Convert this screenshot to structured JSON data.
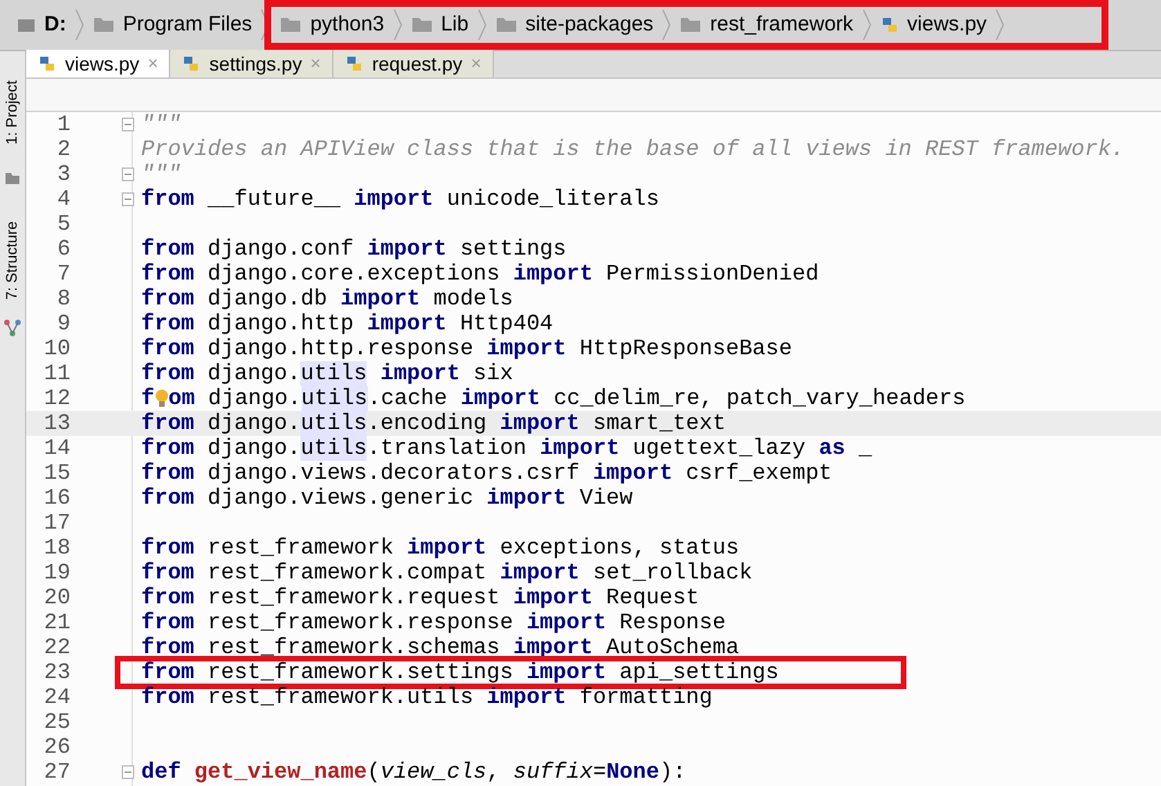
{
  "breadcrumbs": [
    {
      "label": "D:",
      "kind": "drive",
      "boxed": false
    },
    {
      "label": "Program Files",
      "kind": "folder",
      "boxed": false
    },
    {
      "label": "python3",
      "kind": "folder",
      "boxed": true
    },
    {
      "label": "Lib",
      "kind": "folder",
      "boxed": true
    },
    {
      "label": "site-packages",
      "kind": "folder",
      "boxed": true
    },
    {
      "label": "rest_framework",
      "kind": "folder",
      "boxed": true
    },
    {
      "label": "views.py",
      "kind": "python",
      "boxed": true
    }
  ],
  "tabs": [
    {
      "label": "views.py",
      "close": "×",
      "selected": true
    },
    {
      "label": "settings.py",
      "close": "×",
      "selected": false
    },
    {
      "label": "request.py",
      "close": "×",
      "selected": false
    }
  ],
  "side_tools": [
    {
      "label": "1: Project"
    },
    {
      "label": "7: Structure"
    }
  ],
  "lines": [
    {
      "number": "1",
      "fold": true,
      "current": false,
      "boxed": false,
      "segments": [
        {
          "text": "\"\"\"",
          "kind": "comment"
        }
      ]
    },
    {
      "number": "2",
      "fold": false,
      "current": false,
      "boxed": false,
      "segments": [
        {
          "text": "Provides an APIView class that is the base of all views in REST framework.",
          "kind": "comment"
        }
      ]
    },
    {
      "number": "3",
      "fold": true,
      "current": false,
      "boxed": false,
      "segments": [
        {
          "text": "\"\"\"",
          "kind": "comment"
        }
      ]
    },
    {
      "number": "4",
      "fold": true,
      "current": false,
      "boxed": false,
      "segments": [
        {
          "text": "from",
          "kind": "keyword"
        },
        {
          "text": " __future__ ",
          "kind": "plain"
        },
        {
          "text": "import",
          "kind": "keyword"
        },
        {
          "text": " unicode_literals",
          "kind": "plain"
        }
      ]
    },
    {
      "number": "5",
      "fold": false,
      "current": false,
      "boxed": false
    },
    {
      "number": "6",
      "fold": false,
      "current": false,
      "boxed": false,
      "segments": [
        {
          "text": "from",
          "kind": "keyword"
        },
        {
          "text": " django.conf ",
          "kind": "plain"
        },
        {
          "text": "import",
          "kind": "keyword"
        },
        {
          "text": " settings",
          "kind": "plain"
        }
      ]
    },
    {
      "number": "7",
      "fold": false,
      "current": false,
      "boxed": false,
      "segments": [
        {
          "text": "from",
          "kind": "keyword"
        },
        {
          "text": " django.core.exceptions ",
          "kind": "plain"
        },
        {
          "text": "import",
          "kind": "keyword"
        },
        {
          "text": " PermissionDenied",
          "kind": "plain"
        }
      ]
    },
    {
      "number": "8",
      "fold": false,
      "current": false,
      "boxed": false,
      "segments": [
        {
          "text": "from",
          "kind": "keyword"
        },
        {
          "text": " django.db ",
          "kind": "plain"
        },
        {
          "text": "import",
          "kind": "keyword"
        },
        {
          "text": " models",
          "kind": "plain"
        }
      ]
    },
    {
      "number": "9",
      "fold": false,
      "current": false,
      "boxed": false,
      "segments": [
        {
          "text": "from",
          "kind": "keyword"
        },
        {
          "text": " django.http ",
          "kind": "plain"
        },
        {
          "text": "import",
          "kind": "keyword"
        },
        {
          "text": " Http404",
          "kind": "plain"
        }
      ]
    },
    {
      "number": "10",
      "fold": false,
      "current": false,
      "boxed": false,
      "segments": [
        {
          "text": "from",
          "kind": "keyword"
        },
        {
          "text": " django.http.response ",
          "kind": "plain"
        },
        {
          "text": "import",
          "kind": "keyword"
        },
        {
          "text": " HttpResponseBase",
          "kind": "plain"
        }
      ]
    },
    {
      "number": "11",
      "fold": false,
      "current": false,
      "boxed": false,
      "segments": [
        {
          "text": "from",
          "kind": "keyword"
        },
        {
          "text": " django.",
          "kind": "plain"
        },
        {
          "text": "utils",
          "kind": "reference"
        },
        {
          "text": " import",
          "kind": "keyword"
        },
        {
          "text": " six",
          "kind": "plain"
        }
      ]
    },
    {
      "number": "12",
      "fold": false,
      "current": false,
      "boxed": false,
      "segments": [
        {
          "text": "f",
          "kind": "keyword"
        },
        {
          "kind": "bulb"
        },
        {
          "text": "om",
          "kind": "keyword"
        },
        {
          "text": " django.",
          "kind": "plain"
        },
        {
          "text": "utils",
          "kind": "reference"
        },
        {
          "text": ".cache ",
          "kind": "plain"
        },
        {
          "text": "import",
          "kind": "keyword"
        },
        {
          "text": " cc_delim_re, patch_vary_headers",
          "kind": "plain"
        }
      ]
    },
    {
      "number": "13",
      "fold": false,
      "current": true,
      "boxed": false,
      "segments": [
        {
          "text": "from",
          "kind": "keyword"
        },
        {
          "text": " django.",
          "kind": "plain"
        },
        {
          "text": "utils",
          "kind": "reference"
        },
        {
          "text": ".encoding ",
          "kind": "plain"
        },
        {
          "text": "import",
          "kind": "keyword"
        },
        {
          "text": " smart_text",
          "kind": "plain"
        }
      ]
    },
    {
      "number": "14",
      "fold": false,
      "current": false,
      "boxed": false,
      "segments": [
        {
          "text": "from",
          "kind": "keyword"
        },
        {
          "text": " django.",
          "kind": "plain"
        },
        {
          "text": "utils",
          "kind": "reference"
        },
        {
          "text": ".translation ",
          "kind": "plain"
        },
        {
          "text": "import",
          "kind": "keyword"
        },
        {
          "text": " ugettext_lazy ",
          "kind": "plain"
        },
        {
          "text": "as",
          "kind": "keyword"
        },
        {
          "text": " _",
          "kind": "plain"
        }
      ]
    },
    {
      "number": "15",
      "fold": false,
      "current": false,
      "boxed": false,
      "segments": [
        {
          "text": "from",
          "kind": "keyword"
        },
        {
          "text": " django.views.decorators.csrf ",
          "kind": "plain"
        },
        {
          "text": "import",
          "kind": "keyword"
        },
        {
          "text": " csrf_exempt",
          "kind": "plain"
        }
      ]
    },
    {
      "number": "16",
      "fold": false,
      "current": false,
      "boxed": false,
      "segments": [
        {
          "text": "from",
          "kind": "keyword"
        },
        {
          "text": " django.views.generic ",
          "kind": "plain"
        },
        {
          "text": "import",
          "kind": "keyword"
        },
        {
          "text": " View",
          "kind": "plain"
        }
      ]
    },
    {
      "number": "17",
      "fold": false,
      "current": false,
      "boxed": false
    },
    {
      "number": "18",
      "fold": false,
      "current": false,
      "boxed": false,
      "segments": [
        {
          "text": "from",
          "kind": "keyword"
        },
        {
          "text": " rest_framework ",
          "kind": "plain"
        },
        {
          "text": "import",
          "kind": "keyword"
        },
        {
          "text": " exceptions, status",
          "kind": "plain"
        }
      ]
    },
    {
      "number": "19",
      "fold": false,
      "current": false,
      "boxed": false,
      "segments": [
        {
          "text": "from",
          "kind": "keyword"
        },
        {
          "text": " rest_framework.compat ",
          "kind": "plain"
        },
        {
          "text": "import",
          "kind": "keyword"
        },
        {
          "text": " set_rollback",
          "kind": "plain"
        }
      ]
    },
    {
      "number": "20",
      "fold": false,
      "current": false,
      "boxed": false,
      "segments": [
        {
          "text": "from",
          "kind": "keyword"
        },
        {
          "text": " rest_framework.request ",
          "kind": "plain"
        },
        {
          "text": "import",
          "kind": "keyword"
        },
        {
          "text": " Request",
          "kind": "plain"
        }
      ]
    },
    {
      "number": "21",
      "fold": false,
      "current": false,
      "boxed": false,
      "segments": [
        {
          "text": "from",
          "kind": "keyword"
        },
        {
          "text": " rest_framework.response ",
          "kind": "plain"
        },
        {
          "text": "import",
          "kind": "keyword"
        },
        {
          "text": " Response",
          "kind": "plain"
        }
      ]
    },
    {
      "number": "22",
      "fold": false,
      "current": false,
      "boxed": false,
      "segments": [
        {
          "text": "from",
          "kind": "keyword"
        },
        {
          "text": " rest_framework.schemas ",
          "kind": "plain"
        },
        {
          "text": "import",
          "kind": "keyword"
        },
        {
          "text": " AutoSchema",
          "kind": "plain"
        }
      ]
    },
    {
      "number": "23",
      "fold": false,
      "current": false,
      "boxed": true,
      "segments": [
        {
          "text": "from",
          "kind": "keyword"
        },
        {
          "text": " rest_framework.settings ",
          "kind": "plain"
        },
        {
          "text": "import",
          "kind": "keyword"
        },
        {
          "text": " api_settings",
          "kind": "plain"
        }
      ]
    },
    {
      "number": "24",
      "fold": false,
      "current": false,
      "boxed": false,
      "segments": [
        {
          "text": "from",
          "kind": "keyword"
        },
        {
          "text": " rest_framework.utils ",
          "kind": "plain"
        },
        {
          "text": "import",
          "kind": "keyword"
        },
        {
          "text": " formatting",
          "kind": "plain"
        }
      ]
    },
    {
      "number": "25",
      "fold": false,
      "current": false,
      "boxed": false
    },
    {
      "number": "26",
      "fold": false,
      "current": false,
      "boxed": false
    },
    {
      "number": "27",
      "fold": true,
      "current": false,
      "boxed": false,
      "segments": [
        {
          "text": "def ",
          "kind": "keyword"
        },
        {
          "text": "get_view_name",
          "kind": "function"
        },
        {
          "text": "(",
          "kind": "plain"
        },
        {
          "text": "view_cls",
          "kind": "parameter"
        },
        {
          "text": ", ",
          "kind": "plain"
        },
        {
          "text": "suffix",
          "kind": "parameter"
        },
        {
          "text": "=",
          "kind": "plain"
        },
        {
          "text": "None",
          "kind": "keyword"
        },
        {
          "text": "):",
          "kind": "plain"
        }
      ]
    }
  ]
}
